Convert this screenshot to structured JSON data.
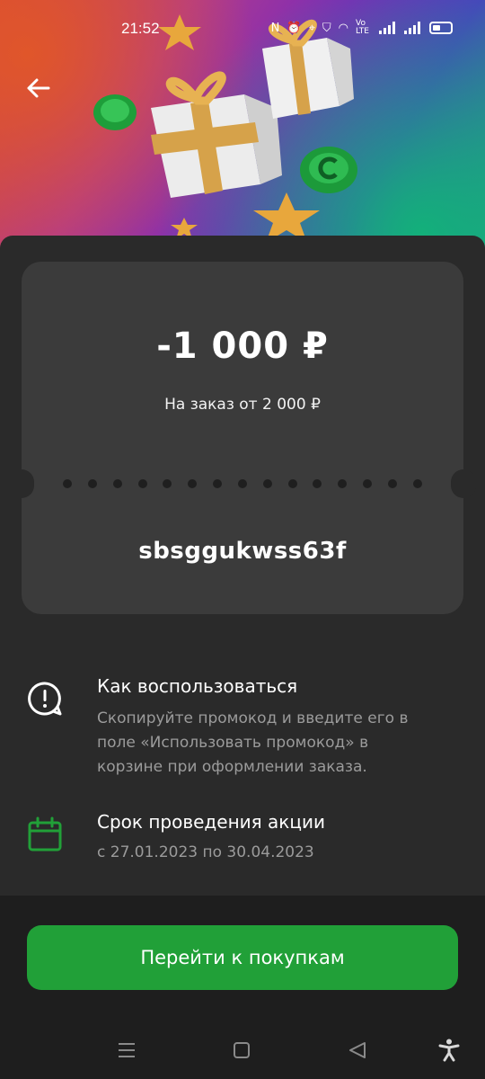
{
  "status_bar": {
    "time": "21:52",
    "icons": [
      "nfc-icon",
      "alarm-icon",
      "location-icon",
      "shield-app-icon",
      "wifi-icon",
      "volte-icon",
      "signal-icon",
      "signal-icon",
      "battery-icon"
    ],
    "volte_label": "Vo LTE"
  },
  "header": {
    "back_icon": "arrow-left-icon"
  },
  "coupon": {
    "amount": "-1 000 ₽",
    "min_order": "На заказ от 2 000 ₽",
    "code": "sbsggukwss63f"
  },
  "info": {
    "how_to": {
      "icon": "chat-exclamation-icon",
      "title": "Как воспользоваться",
      "text": "Скопируйте промокод и введите его в поле «Использовать промокод» в корзине при оформлении заказа."
    },
    "period": {
      "icon": "calendar-icon",
      "title": "Срок проведения акции",
      "text": "с 27.01.2023 по 30.04.2023"
    }
  },
  "cta": {
    "label": "Перейти к покупкам"
  },
  "colors": {
    "accent": "#21a038",
    "sheet": "#2a2a2a",
    "card": "#3b3b3b",
    "muted_text": "#9b9b9b"
  },
  "navbar": {
    "icons": [
      "menu-icon",
      "home-square-icon",
      "back-triangle-icon",
      "accessibility-icon"
    ]
  }
}
